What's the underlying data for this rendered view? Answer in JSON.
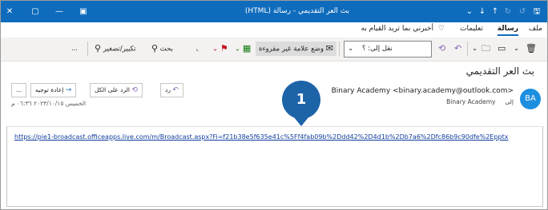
{
  "window": {
    "title": "بث العر التقديمي - رسالة (HTML)",
    "title_icons": [
      "close-icon",
      "restore-icon",
      "minimize-icon",
      "app-options-icon"
    ],
    "qat": [
      "save-icon",
      "undo-icon",
      "redo-icon",
      "up-icon",
      "down-icon",
      "customize-icon"
    ]
  },
  "menu": {
    "file": "ملف",
    "message": "رسالة",
    "help": "تعليمات",
    "tellme": "أخبرني بما تريد القيام به"
  },
  "ribbon": {
    "move_placeholder": "نقل إلى: ؟",
    "mark_unread": "وضع علامة غير مقروءة",
    "search": "بحث",
    "zoom": "تكبير/تصغير",
    "more": "..."
  },
  "email": {
    "subject": "بث العر التقديمي",
    "avatar": "BA",
    "sender": "Binary Academy <binary.academy@outlook.com>",
    "to_label": "إلى",
    "to_value": "Binary Academy",
    "reply": "رد",
    "reply_all": "الرد على الكل",
    "forward": "إعادة توجيه",
    "more": "...",
    "datetime": "الخميس ٢٠٢٣/١٠/١٥ ٠٦:٣٦ م",
    "link": "https://pie1-broadcast.officeapps.live.com/m/Broadcast.aspx?Fi=f21b38e5f635e41c%5Ff4fab09b%2Ddd42%2D4d1b%2Db7a6%2Dfc86b9c90dfe%2Epptx"
  },
  "callout": {
    "number": "1",
    "color": "#1d63a8"
  },
  "colors": {
    "titlebar": "#0f6cbd",
    "accent": "#0f6cbd"
  }
}
